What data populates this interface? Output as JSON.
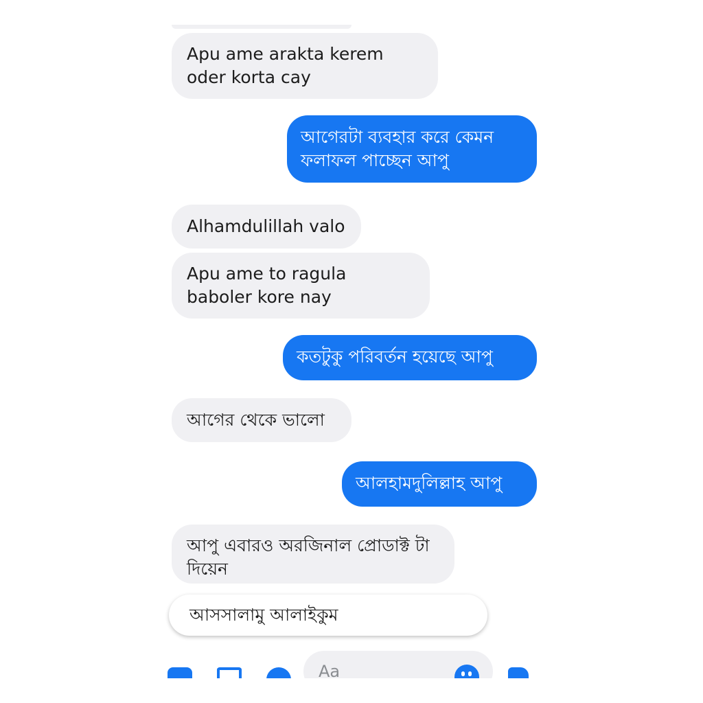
{
  "messages": [
    {
      "from": "them",
      "text": "Apu ame arakta kerem oder korta cay"
    },
    {
      "from": "me",
      "text": "আগেরটা ব্যবহার করে কেমন ফলাফল পাচ্ছেন আপু"
    },
    {
      "from": "them",
      "text": "Alhamdulillah valo"
    },
    {
      "from": "them",
      "text": "Apu ame to ragula baboler kore nay"
    },
    {
      "from": "me",
      "text": "কতটুকু পরিবর্তন হয়েছে আপু"
    },
    {
      "from": "them",
      "text": "আগের থেকে ভালো"
    },
    {
      "from": "me",
      "text": "আলহামদুলিল্লাহ আপু"
    },
    {
      "from": "them",
      "text": "আপু এবারও অরজিনাল প্রোডাক্ট টা দিয়েন"
    }
  ],
  "quick_reply": "আসসালামু আলাইকুম",
  "composer": {
    "placeholder": "Aa",
    "icons": [
      "camera-icon",
      "gallery-icon",
      "mic-icon",
      "emoji-icon",
      "like-icon"
    ]
  },
  "colors": {
    "outgoing": "#1777f2",
    "incoming": "#f0f0f3",
    "accent": "#1777f2"
  }
}
